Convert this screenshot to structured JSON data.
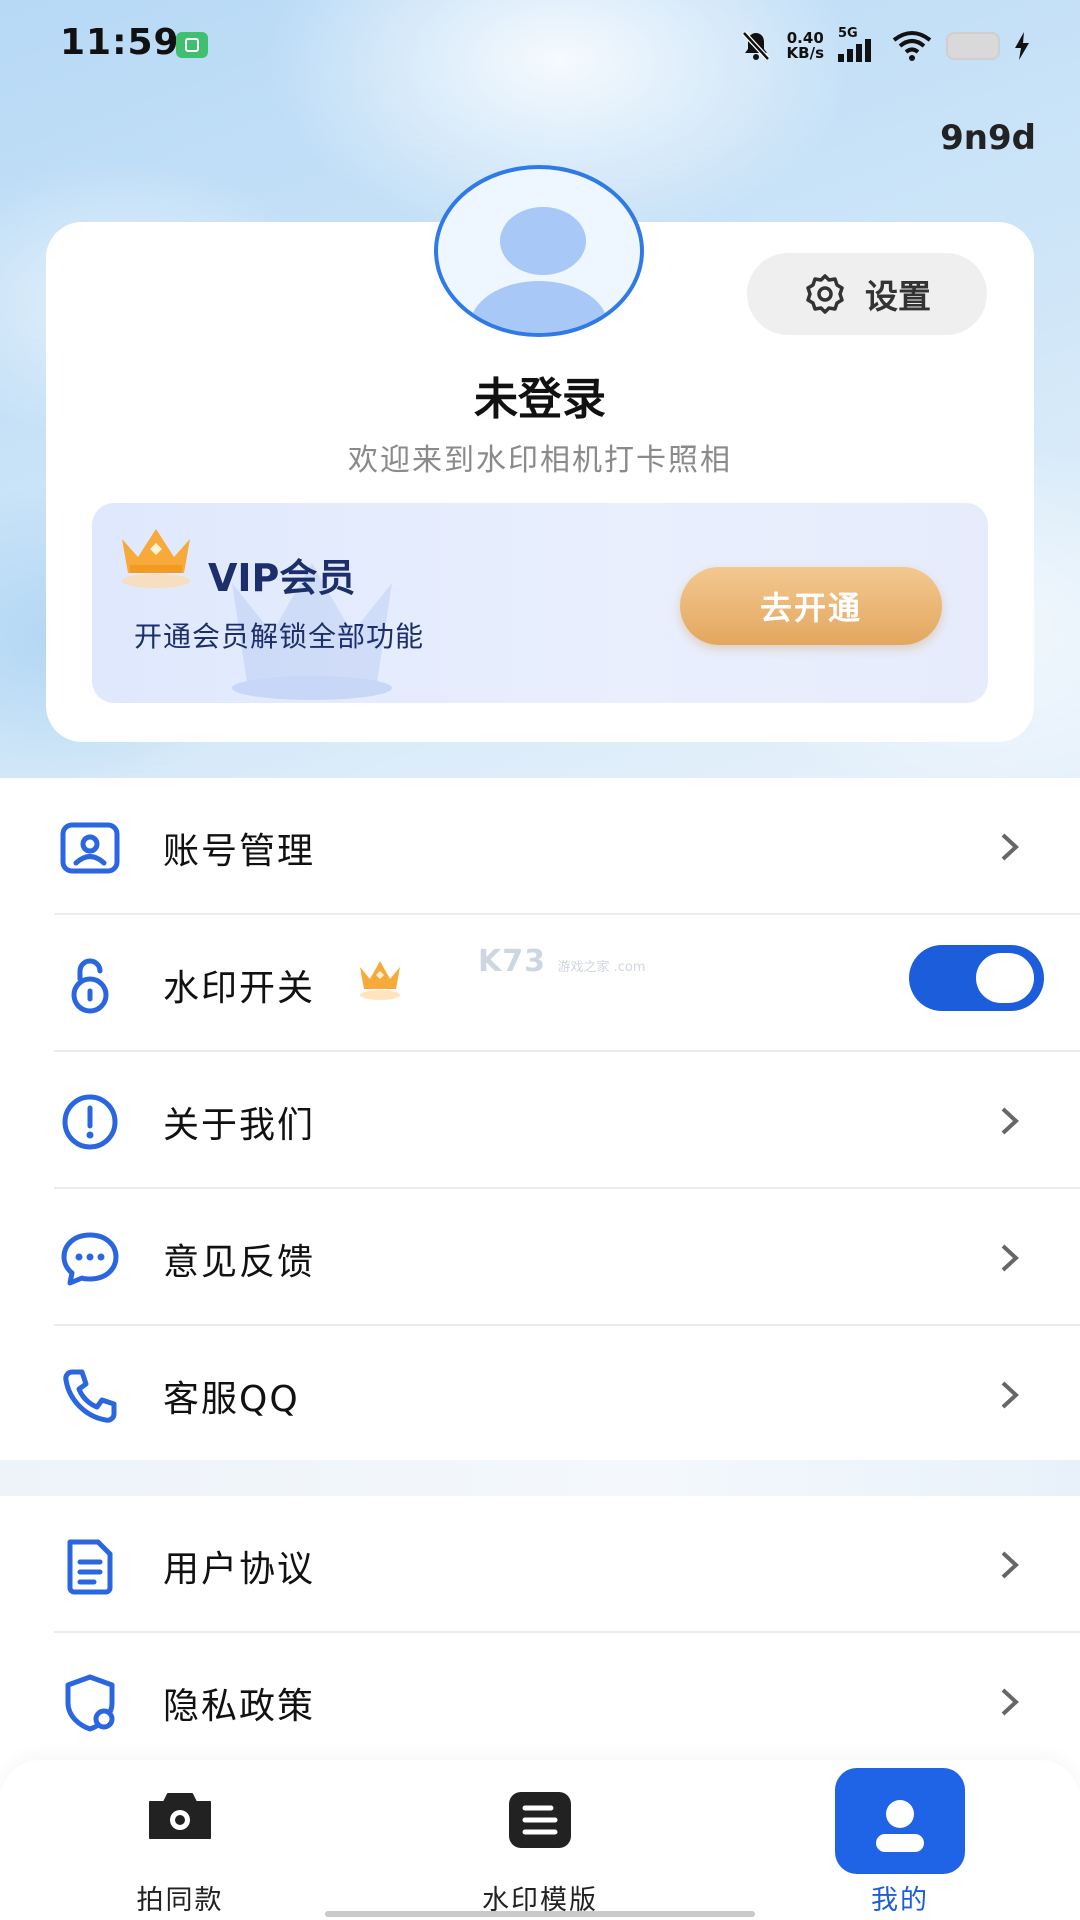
{
  "status_bar": {
    "time": "11:59",
    "net_speed_value": "0.40",
    "net_speed_unit": "KB/s",
    "network_type": "5G"
  },
  "corner_tag": "9n9d",
  "profile": {
    "username": "未登录",
    "welcome": "欢迎来到水印相机打卡照相",
    "settings_label": "设置"
  },
  "vip": {
    "title": "VIP会员",
    "subtitle": "开通会员解锁全部功能",
    "button_label": "去开通"
  },
  "menu": {
    "account": "账号管理",
    "watermark_switch": "水印开关",
    "watermark_switch_on": true,
    "about": "关于我们",
    "feedback": "意见反馈",
    "qq_service": "客服QQ",
    "user_agreement": "用户协议",
    "privacy_policy": "隐私政策"
  },
  "watermark_overlay": {
    "brand": "K73",
    "sub": "游戏之家 .com"
  },
  "bottom_nav": {
    "items": [
      {
        "label": "拍同款",
        "icon": "camera-icon"
      },
      {
        "label": "水印模版",
        "icon": "template-icon"
      },
      {
        "label": "我的",
        "icon": "profile-icon",
        "active": true
      }
    ]
  },
  "colors": {
    "accent": "#1b5ddb",
    "vip_button": "#e8b06c",
    "icon_blue": "#2a66e0"
  }
}
